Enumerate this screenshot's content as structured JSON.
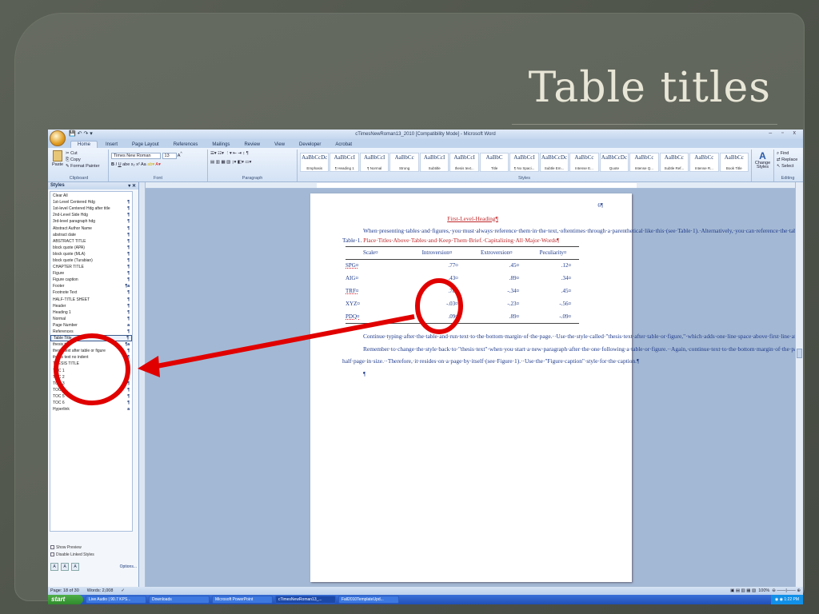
{
  "slide": {
    "title": "Table titles"
  },
  "window": {
    "title": "cTimesNewRoman13_2010 [Compatibility Mode] - Microsoft Word",
    "controls": "– ▫ x"
  },
  "ribbon": {
    "tabs": [
      "Home",
      "Insert",
      "Page Layout",
      "References",
      "Mailings",
      "Review",
      "View",
      "Developer",
      "Acrobat"
    ],
    "clipboard": {
      "paste": "Paste",
      "cut": "Cut",
      "copy": "Copy",
      "format_painter": "Format Painter",
      "label": "Clipboard"
    },
    "font": {
      "name": "Times New Roman",
      "size": "13",
      "label": "Font"
    },
    "paragraph_label": "Paragraph",
    "styles_label": "Styles",
    "editing_label": "Editing",
    "editing": {
      "find": "Find",
      "replace": "Replace",
      "select": "Select"
    },
    "change_styles": "Change Styles",
    "gallery": [
      {
        "sample": "AaBbCcDc",
        "name": "Emphasis"
      },
      {
        "sample": "AaBbCcI",
        "name": "¶ Heading 1"
      },
      {
        "sample": "AaBbCcI",
        "name": "¶ Normal"
      },
      {
        "sample": "AaBbCc",
        "name": "Strong"
      },
      {
        "sample": "AaBbCcI",
        "name": "Subtitle"
      },
      {
        "sample": "AaBbCcI",
        "name": "thesis text..."
      },
      {
        "sample": "AaBbC",
        "name": "Title"
      },
      {
        "sample": "AaBbCcI",
        "name": "¶ No Spaci..."
      },
      {
        "sample": "AaBbCcDc",
        "name": "Subtle Em..."
      },
      {
        "sample": "AaBbCc",
        "name": "Intense E..."
      },
      {
        "sample": "AaBbCcDc",
        "name": "Quote"
      },
      {
        "sample": "AaBbCc",
        "name": "Intense Q..."
      },
      {
        "sample": "AaBbCc",
        "name": "Subtle Ref..."
      },
      {
        "sample": "AaBbCc",
        "name": "Intense R..."
      },
      {
        "sample": "AaBbCc",
        "name": "Book Title"
      }
    ]
  },
  "styles_pane": {
    "title": "Styles",
    "items": [
      {
        "name": "Clear All",
        "mark": ""
      },
      {
        "name": "1st-Level Centered Hdg",
        "mark": "¶"
      },
      {
        "name": "1st-level Centered Hdg after title",
        "mark": "¶"
      },
      {
        "name": "2nd-Level Side Hdg",
        "mark": "¶"
      },
      {
        "name": "3rd-level paragraph hdg",
        "mark": "¶"
      },
      {
        "name": "Abstract Author Name",
        "mark": "¶"
      },
      {
        "name": "abstract date",
        "mark": "¶"
      },
      {
        "name": "ABSTRACT TITLE",
        "mark": "¶"
      },
      {
        "name": "block quote (APA)",
        "mark": "¶"
      },
      {
        "name": "block quote (MLA)",
        "mark": "¶"
      },
      {
        "name": "block quote (Turabian)",
        "mark": "¶"
      },
      {
        "name": "CHAPTER TITLE",
        "mark": "¶"
      },
      {
        "name": "Figure",
        "mark": "¶"
      },
      {
        "name": "Figure caption",
        "mark": "¶"
      },
      {
        "name": "Footer",
        "mark": "¶a"
      },
      {
        "name": "Footnote Text",
        "mark": "¶"
      },
      {
        "name": "HALF-TITLE SHEET",
        "mark": "¶"
      },
      {
        "name": "Header",
        "mark": "¶"
      },
      {
        "name": "Heading 1",
        "mark": "¶"
      },
      {
        "name": "Normal",
        "mark": "¶"
      },
      {
        "name": "Page Number",
        "mark": "a"
      },
      {
        "name": "References",
        "mark": "¶"
      },
      {
        "name": "Table Title",
        "mark": "¶"
      },
      {
        "name": "thesis text",
        "mark": "¶a"
      },
      {
        "name": "thesis text after table or figure",
        "mark": "¶"
      },
      {
        "name": "thesis text no indent",
        "mark": "¶"
      },
      {
        "name": "THESIS TITLE",
        "mark": "¶"
      },
      {
        "name": "TOC 1",
        "mark": "¶"
      },
      {
        "name": "TOC 2",
        "mark": "¶"
      },
      {
        "name": "TOC 3",
        "mark": "¶"
      },
      {
        "name": "TOC 4",
        "mark": "¶"
      },
      {
        "name": "TOC 5",
        "mark": "¶"
      },
      {
        "name": "TOC 6",
        "mark": "¶"
      },
      {
        "name": "Hyperlink",
        "mark": "a"
      }
    ],
    "selected": "Table Title",
    "show_preview": "Show Preview",
    "disable_linked": "Disable Linked Styles",
    "options": "Options..."
  },
  "document": {
    "page_number": "6¶",
    "heading": "First-Level-Heading¶",
    "paragraph1": "When·presenting·tables·and·figures,·you·must·always·reference·them·in·the·text,·oftentimes·through·a·parenthetical·like·this·(see·Table·1).·Alternatively,·you·can·reference·the·table·or·figure·in·a·sentence·like·this:·\"Table·1·shows·the·scales·used·and·the·standard·deviations·for·each·variable.\"··The·table·or·figure·must·follow·as·closely·as·possible·after·the·paragraph·in·which·it·is·referenced.··Use·the·\"Table·Title\"·style·for·the·title,·as·shown·below.¶",
    "caption_label": "Table·1.",
    "caption_red": "Place·Titles·Above·Tables·and·Keep·Them·Brief.·Capitalizing·All·Major·Words¶",
    "table": {
      "headers": [
        "Scale¤",
        "Introversion¤",
        "Extroversion¤",
        "Peculiarity¤"
      ],
      "rows": [
        [
          "SPG¤",
          ".77¤",
          ".45¤",
          ".12¤"
        ],
        [
          "AIG¤",
          ".43¤",
          ".89¤",
          ".34¤"
        ],
        [
          "TRF¤",
          ".78¤",
          "-.34¤",
          ".45¤"
        ],
        [
          "XYZ¤",
          "-.03¤",
          "-.23¤",
          "-.56¤"
        ],
        [
          "PDQ¤",
          ".09¤",
          ".89¤",
          "-.09¤"
        ]
      ]
    },
    "paragraph2": "Continue·typing·after·the·table·and·run·text·to·the·bottom·margin·of·the·page.··Use·the·style·called·\"thesis·text·after·table·or·figure,\"·which·adds·one·line·space·above·first·line·after·table.¶",
    "paragraph3": "Remember·to·change·the·style·back·to·\"thesis·text\"·when·you·start·a·new·paragraph·after·the·one·following·a·table·or·figure.··Again,·continue·text·to·the·bottom·margin·of·the·page.··You·may·have·another·reference·in·here·to·a·table·or·figure.··The·example·on·the·next·page·is·a·figure·more·than·one-half·page·in·size.··Therefore,·it·resides·on·a·page·by·itself·(see·Figure·1).··Use·the·\"Figure·caption\"·style·for·the·caption.¶",
    "end_mark": "¶"
  },
  "status": {
    "page": "Page: 18 of 30",
    "words": "Words: 2,008",
    "zoom": "100%"
  },
  "taskbar": {
    "start": "start",
    "tasks": [
      "Live Audio | 90.7 KPS...",
      "Downloads",
      "Microsoft PowerPoint",
      "cTimesNewRoman13_...",
      "Fall2010TemplateUpd..."
    ],
    "clock": "1:22 PM"
  },
  "colors": {
    "annotation_red": "#e10000",
    "ribbon_blue": "#c9d9ee",
    "slide_bg": "#5a5f56"
  }
}
